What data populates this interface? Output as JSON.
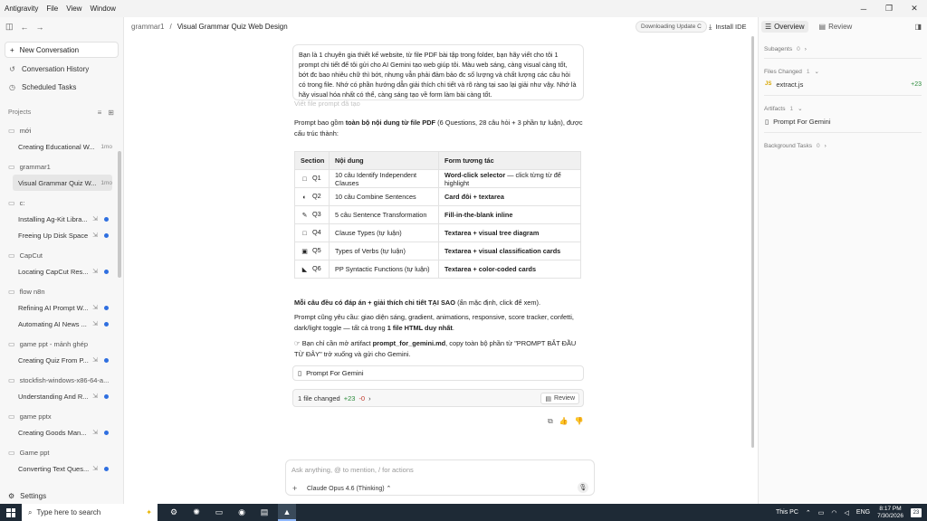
{
  "menubar": {
    "app": "Antigravity",
    "items": [
      "File",
      "View",
      "Window"
    ]
  },
  "sidebar": {
    "new_conversation": "New Conversation",
    "links": [
      "Conversation History",
      "Scheduled Tasks"
    ],
    "projects_label": "Projects",
    "projects": [
      {
        "name": "mới",
        "convs": [
          {
            "title": "Creating Educational W...",
            "meta": "1mo",
            "dot": false,
            "pin": false
          }
        ]
      },
      {
        "name": "grammar1",
        "convs": [
          {
            "title": "Visual Grammar Quiz W...",
            "meta": "1mo",
            "dot": false,
            "pin": false,
            "active": true
          }
        ]
      },
      {
        "name": "c:",
        "convs": [
          {
            "title": "Installing Ag-Kit Libra...",
            "dot": true,
            "pin": true
          },
          {
            "title": "Freeing Up Disk Space",
            "dot": true,
            "pin": true
          }
        ]
      },
      {
        "name": "CapCut",
        "convs": [
          {
            "title": "Locating CapCut Res...",
            "dot": true,
            "pin": true
          }
        ]
      },
      {
        "name": "flow n8n",
        "convs": [
          {
            "title": "Refining AI Prompt W...",
            "dot": true,
            "pin": true
          },
          {
            "title": "Automating AI News ...",
            "dot": true,
            "pin": true
          }
        ]
      },
      {
        "name": "game ppt - mảnh ghép",
        "convs": [
          {
            "title": "Creating Quiz From P...",
            "dot": true,
            "pin": true
          }
        ]
      },
      {
        "name": "stockfish-windows-x86-64-a...",
        "convs": [
          {
            "title": "Understanding And R...",
            "dot": true,
            "pin": true
          }
        ]
      },
      {
        "name": "game pptx",
        "convs": [
          {
            "title": "Creating Goods Man...",
            "dot": true,
            "pin": true
          }
        ]
      },
      {
        "name": "Game ppt",
        "convs": [
          {
            "title": "Converting Text Ques...",
            "dot": true,
            "pin": true
          }
        ]
      }
    ],
    "settings": "Settings"
  },
  "header": {
    "breadcrumb_project": "grammar1",
    "breadcrumb_sep": "/",
    "breadcrumb_title": "Visual Grammar Quiz Web Design",
    "download_status": "Downloading Update C",
    "install_ide": "Install IDE"
  },
  "right_panel": {
    "tabs": [
      "Overview",
      "Review"
    ],
    "subagents": {
      "label": "Subagents",
      "count": "0"
    },
    "files_changed": {
      "label": "Files Changed",
      "count": "1",
      "files": [
        {
          "name": "extract.js",
          "badge": "JS",
          "diff": "+23"
        }
      ]
    },
    "artifacts": {
      "label": "Artifacts",
      "count": "1",
      "items": [
        "Prompt For Gemini"
      ]
    },
    "background_tasks": {
      "label": "Background Tasks",
      "count": "0"
    }
  },
  "chat": {
    "user_message": "Bạn là 1 chuyên gia thiết kế website, từ file PDF bài tập trong folder, bạn hãy viết cho tôi 1 prompt chi tiết để tôi gửi cho AI Gemini tạo web giúp tôi. Màu web sáng, càng visual càng tốt, bớt đc bao nhiêu chữ thì bớt, nhưng vẫn phải đảm bảo đc số lượng và chất lượng các câu hỏi có trong file. Nhớ có phần hướng dẫn giải thích chi tiết và rõ ràng tại sao lại giải như vậy. Nhớ là hãy visual hóa nhất có thể, càng sáng tạo về form làm bài càng tốt.",
    "ghost_line": "Viết file prompt đã tạo",
    "intro_pre": "Prompt bao gồm ",
    "intro_bold": "toàn bộ nội dung từ file PDF",
    "intro_post": " (6 Questions, 28 câu hỏi + 3 phần tự luận), được cấu trúc thành:",
    "table": {
      "headers": [
        "Section",
        "Nội dung",
        "Form tương tác"
      ],
      "rows": [
        {
          "icon": "□",
          "section": "Q1",
          "content": "10 câu Identify Independent Clauses",
          "form_bold": "Word-click selector",
          "form_rest": " — click từng từ để highlight"
        },
        {
          "icon": "◐",
          "section": "Q2",
          "content": "10 câu Combine Sentences",
          "form_bold": "Card đôi + textarea",
          "form_rest": ""
        },
        {
          "icon": "✎",
          "section": "Q3",
          "content": "5 câu Sentence Transformation",
          "form_bold": "Fill-in-the-blank inline",
          "form_rest": ""
        },
        {
          "icon": "□",
          "section": "Q4",
          "content": "Clause Types (tự luận)",
          "form_bold": "Textarea + visual tree diagram",
          "form_rest": ""
        },
        {
          "icon": "▣",
          "section": "Q5",
          "content": "Types of Verbs (tự luận)",
          "form_bold": "Textarea + visual classification cards",
          "form_rest": ""
        },
        {
          "icon": "◣",
          "section": "Q6",
          "content": "PP Syntactic Functions (tự luận)",
          "form_bold": "Textarea + color-coded cards",
          "form_rest": ""
        }
      ]
    },
    "note1_bold": "Mỗi câu đều có đáp án + giải thích chi tiết TẠI SAO",
    "note1_rest": " (ẩn mặc định, click để xem).",
    "note2_pre": "Prompt cũng yêu cầu: giao diện sáng, gradient, animations, responsive, score tracker, confetti, dark/light toggle — tất cả trong ",
    "note2_bold": "1 file HTML duy nhất",
    "note2_post": ".",
    "note3_pre": "Bạn chỉ cần mở artifact ",
    "note3_bold": "prompt_for_gemini.md",
    "note3_post": ", copy toàn bộ phần từ \"PROMPT BẮT ĐẦU TỪ ĐÂY\" trở xuống và gửi cho Gemini.",
    "artifact_card": "Prompt For Gemini",
    "changed_label": "1 file changed",
    "changed_add": "+23",
    "changed_del": "-0",
    "review_btn": "Review"
  },
  "input": {
    "placeholder": "Ask anything, @ to mention, / for actions",
    "model": "Claude Opus 4.6 (Thinking)"
  },
  "taskbar": {
    "search": "Type here to search",
    "this_pc": "This PC",
    "lang": "ENG",
    "time": "8:17 PM",
    "date": "7/30/2026",
    "notif_count": "23"
  }
}
